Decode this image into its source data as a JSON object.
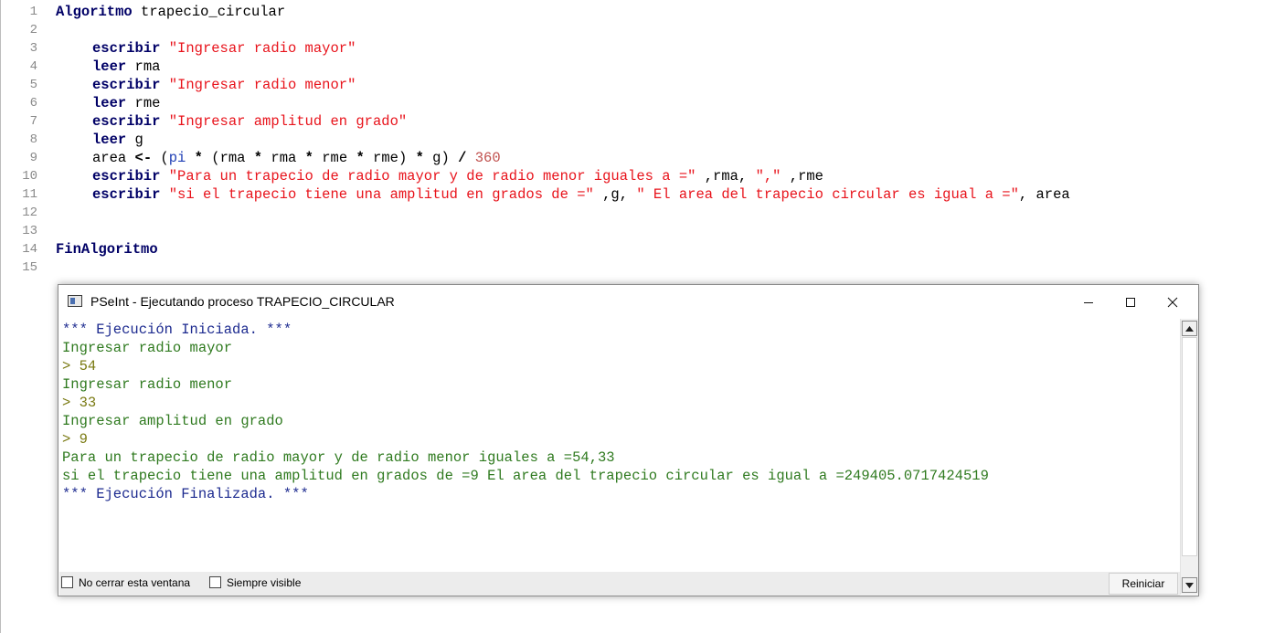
{
  "editor": {
    "lines": [
      {
        "n": "1"
      },
      {
        "n": "2"
      },
      {
        "n": "3"
      },
      {
        "n": "4"
      },
      {
        "n": "5"
      },
      {
        "n": "6"
      },
      {
        "n": "7"
      },
      {
        "n": "8"
      },
      {
        "n": "9"
      },
      {
        "n": "10"
      },
      {
        "n": "11"
      },
      {
        "n": "12"
      },
      {
        "n": "13"
      },
      {
        "n": "14"
      },
      {
        "n": "15"
      }
    ],
    "tokens": {
      "l1_kw": "Algoritmo",
      "l1_id": " trapecio_circular",
      "l3_kw": "escribir",
      "l3_str": "\"Ingresar radio mayor\"",
      "l4_kw": "leer",
      "l4_id": " rma",
      "l5_kw": "escribir",
      "l5_str": "\"Ingresar radio menor\"",
      "l6_kw": "leer",
      "l6_id": " rme",
      "l7_kw": "escribir",
      "l7_str": "\"Ingresar amplitud en grado\"",
      "l8_kw": "leer",
      "l8_id": " g",
      "l9_a": "area ",
      "l9_assign": "<-",
      "l9_b": " (",
      "l9_pi": "pi",
      "l9_c": " ",
      "l9_m1": "*",
      "l9_d": " (rma ",
      "l9_m2": "*",
      "l9_e": " rma ",
      "l9_m3": "*",
      "l9_f": " rme ",
      "l9_m4": "*",
      "l9_g": " rme) ",
      "l9_m5": "*",
      "l9_h": " g) ",
      "l9_div": "/",
      "l9_i": " ",
      "l9_num": "360",
      "l10_kw": "escribir",
      "l10_str1": "\"Para un trapecio de radio mayor y de radio menor iguales a =\"",
      "l10_a": " ,rma, ",
      "l10_str2": "\",\"",
      "l10_b": " ,rme",
      "l11_kw": "escribir",
      "l11_str1": "\"si el trapecio tiene una amplitud en grados de =\"",
      "l11_a": " ,g, ",
      "l11_str2": "\" El area del trapecio circular es igual a =\"",
      "l11_b": ", area",
      "l14_kw": "FinAlgoritmo"
    }
  },
  "window": {
    "title": "PSeInt - Ejecutando proceso TRAPECIO_CIRCULAR",
    "minimize": "—",
    "maximize": "☐",
    "close": "✕"
  },
  "console": {
    "lines": [
      {
        "text": "*** Ejecución Iniciada. ***",
        "kind": "sys"
      },
      {
        "text": "Ingresar radio mayor",
        "kind": "out"
      },
      {
        "text": "> 54",
        "kind": "in"
      },
      {
        "text": "Ingresar radio menor",
        "kind": "out"
      },
      {
        "text": "> 33",
        "kind": "in"
      },
      {
        "text": "Ingresar amplitud en grado",
        "kind": "out"
      },
      {
        "text": "> 9",
        "kind": "in"
      },
      {
        "text": "Para un trapecio de radio mayor y de radio menor iguales a =54,33",
        "kind": "out"
      },
      {
        "text": "si el trapecio tiene una amplitud en grados de =9 El area del trapecio circular es igual a =249405.0717424519",
        "kind": "out"
      },
      {
        "text": "*** Ejecución Finalizada. ***",
        "kind": "sys"
      }
    ]
  },
  "bottom": {
    "keep_open_label": "No cerrar esta ventana",
    "always_visible_label": "Siempre visible",
    "restart_label": "Reiniciar"
  },
  "colors": {
    "keyword": "#000066",
    "string": "#e8131b",
    "console_system": "#1c2a8f",
    "console_output": "#2f7a1f",
    "console_input": "#7a7a12"
  }
}
